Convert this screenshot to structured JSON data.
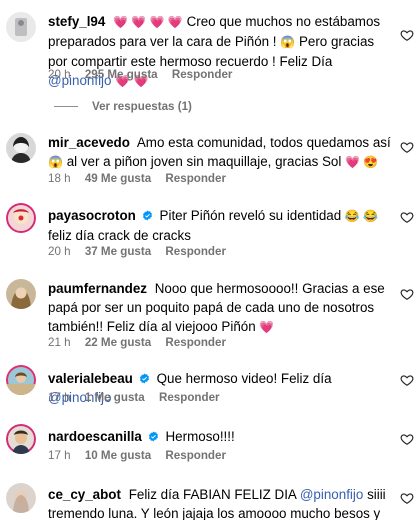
{
  "comments": [
    {
      "username": "stefy_l94",
      "text_parts": [
        "💗 💗 💗 💗",
        " Creo que muchos no estábamos preparados para ver la cara de Piñón ! ",
        "😱",
        " Pero gracias por compartir este hermoso recuerdo ! Feliz Día ",
        "@pinonfijo",
        " ",
        "💗 💗"
      ],
      "time": "20 h",
      "likes": "295 Me gusta",
      "reply": "Responder",
      "view_replies": "Ver respuestas (1)"
    },
    {
      "username": "mir_acevedo",
      "text_parts": [
        "Amo esta comunidad, todos quedamos así ",
        "😱",
        " al ver a piñon joven sin maquillaje, gracias Sol ",
        "💗 😍"
      ],
      "time": "18 h",
      "likes": "49 Me gusta",
      "reply": "Responder"
    },
    {
      "username": "payasocroton",
      "verified": true,
      "text_parts": [
        "Piter Piñón reveló su identidad ",
        "😂 😂",
        " feliz día crack de cracks"
      ],
      "time": "20 h",
      "likes": "37 Me gusta",
      "reply": "Responder"
    },
    {
      "username": "paumfernandez",
      "text_parts": [
        "Nooo que hermosoooo!! Gracias a ese papá por ser un poquito papá de cada uno de nosotros también!! Feliz día al viejooo Piñón ",
        "💗"
      ],
      "time": "21 h",
      "likes": "22 Me gusta",
      "reply": "Responder"
    },
    {
      "username": "valerialebeau",
      "verified": true,
      "text_parts": [
        "Que hermoso video! Feliz día ",
        "@pinonfijo"
      ],
      "time": "17 h",
      "likes": "1 Me gusta",
      "reply": "Responder"
    },
    {
      "username": "nardoescanilla",
      "verified": true,
      "text_parts": [
        "Hermoso!!!!"
      ],
      "time": "17 h",
      "likes": "10 Me gusta",
      "reply": "Responder"
    },
    {
      "username": "ce_cy_abot",
      "text_parts": [
        "Feliz día FABIAN FELIZ DIA ",
        "@pinonfijo",
        " siiii tremendo luna. Y león jajaja los amoooo mucho besos y"
      ]
    }
  ],
  "colors": {
    "mention": "#375fb0",
    "meta": "#737373",
    "verified": "#0095f6",
    "heart_emoji": "#e0245e"
  },
  "icons": {
    "like": "heart-outline-icon",
    "verified": "verified-badge-icon"
  }
}
